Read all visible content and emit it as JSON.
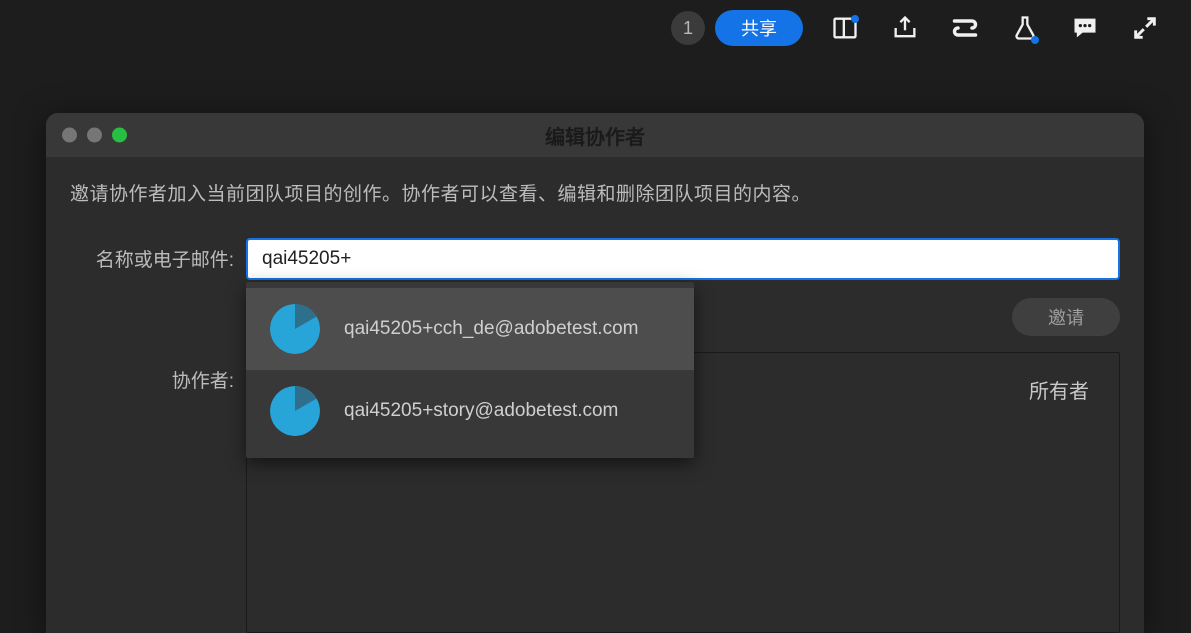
{
  "toolbar": {
    "count_badge": "1",
    "share_label": "共享"
  },
  "dialog": {
    "title": "编辑协作者",
    "description": "邀请协作者加入当前团队项目的创作。协作者可以查看、编辑和删除团队项目的内容。",
    "email_label": "名称或电子邮件:",
    "email_value": "qai45205+",
    "invite_label": "邀请",
    "collaborators_label": "协作者:",
    "owner_role": "所有者",
    "suggestions": [
      {
        "email": "qai45205+cch_de@adobetest.com"
      },
      {
        "email": "qai45205+story@adobetest.com"
      }
    ]
  },
  "colors": {
    "accent": "#1473e6",
    "avatar_main": "#27a5d9",
    "avatar_wedge": "#2e6f8c"
  }
}
